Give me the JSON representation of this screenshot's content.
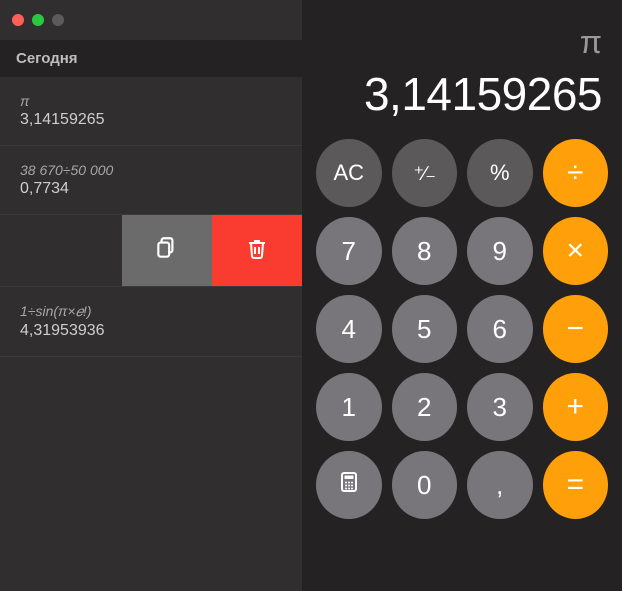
{
  "sidebar": {
    "today_label": "Сегодня",
    "history": [
      {
        "expr": "π",
        "result": "3,14159265"
      },
      {
        "expr": "38 670÷50 000",
        "result": "0,7734"
      },
      {
        "swiped": true
      },
      {
        "expr": "1÷sin(π×𝑒!)",
        "result": "4,31953936"
      }
    ]
  },
  "display": {
    "mode": "π",
    "value": "3,14159265"
  },
  "keys": {
    "ac": "AC",
    "sign": "⁺∕₋",
    "percent": "%",
    "divide": "÷",
    "k7": "7",
    "k8": "8",
    "k9": "9",
    "multiply": "×",
    "k4": "4",
    "k5": "5",
    "k6": "6",
    "minus": "−",
    "k1": "1",
    "k2": "2",
    "k3": "3",
    "plus": "+",
    "k0": "0",
    "decimal": ",",
    "equals": "="
  }
}
